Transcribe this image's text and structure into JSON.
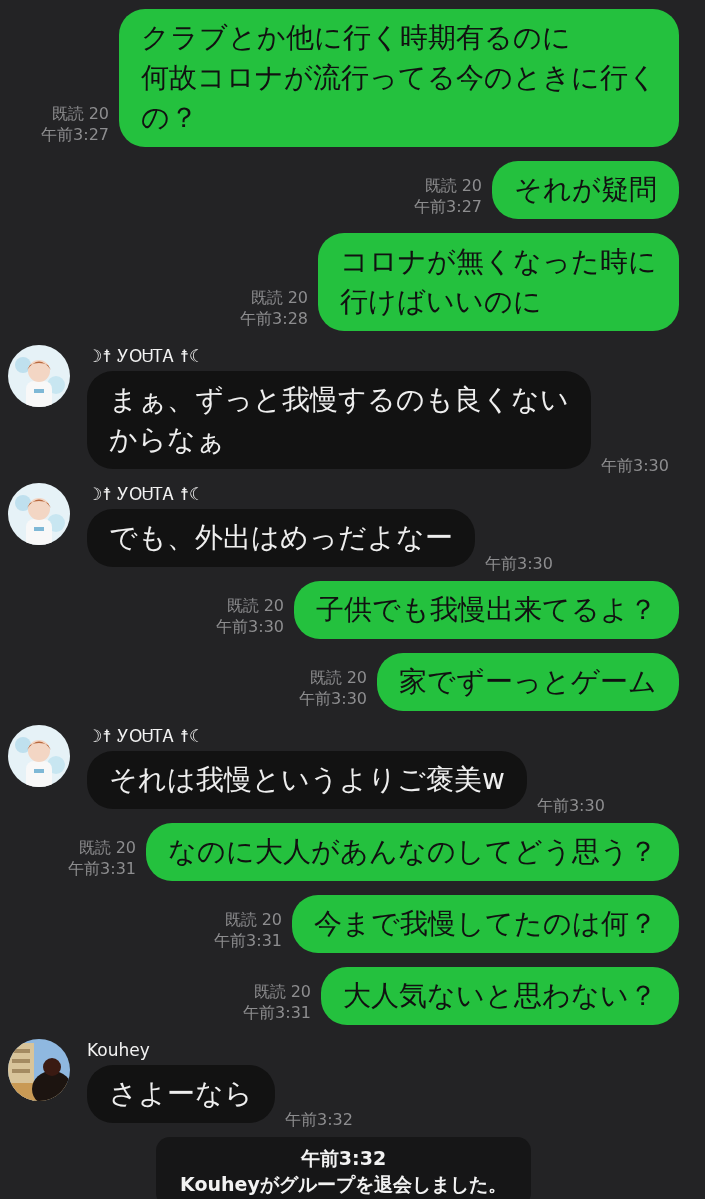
{
  "messages": [
    {
      "kind": "sent",
      "lines": [
        "クラブとか他に行く時期有るのに",
        "何故コロナが流行ってる今のときに行く",
        "の？"
      ],
      "read": "既読 20",
      "time": "午前3:27"
    },
    {
      "kind": "sent",
      "lines": [
        "それが疑問"
      ],
      "read": "既読 20",
      "time": "午前3:27"
    },
    {
      "kind": "sent",
      "lines": [
        "コロナが無くなった時に",
        "行けばいいのに"
      ],
      "read": "既読 20",
      "time": "午前3:28"
    },
    {
      "kind": "received",
      "name": "☽☨ ᎩOᏌᎢᎪ ☨☾",
      "lines": [
        "まぁ、ずっと我慢するのも良くない",
        "からなぁ"
      ],
      "time": "午前3:30"
    },
    {
      "kind": "received",
      "name": "☽☨ ᎩOᏌᎢᎪ ☨☾",
      "lines": [
        "でも、外出はめっだよなー"
      ],
      "time": "午前3:30"
    },
    {
      "kind": "sent",
      "lines": [
        "子供でも我慢出来てるよ？"
      ],
      "read": "既読 20",
      "time": "午前3:30"
    },
    {
      "kind": "sent",
      "lines": [
        "家でずーっとゲーム"
      ],
      "read": "既読 20",
      "time": "午前3:30"
    },
    {
      "kind": "received",
      "name": "☽☨ ᎩOᏌᎢᎪ ☨☾",
      "lines": [
        "それは我慢というよりご褒美w"
      ],
      "time": "午前3:30"
    },
    {
      "kind": "sent",
      "lines": [
        "なのに大人があんなのしてどう思う？"
      ],
      "read": "既読 20",
      "time": "午前3:31"
    },
    {
      "kind": "sent",
      "lines": [
        "今まで我慢してたのは何？"
      ],
      "read": "既読 20",
      "time": "午前3:31"
    },
    {
      "kind": "sent",
      "lines": [
        "大人気ないと思わない？"
      ],
      "read": "既読 20",
      "time": "午前3:31"
    },
    {
      "kind": "received",
      "name": "Kouhey",
      "lines": [
        "さよーなら"
      ],
      "time": "午前3:32"
    },
    {
      "kind": "system",
      "time": "午前3:32",
      "text": "Kouheyがグループを退会しました。"
    }
  ]
}
